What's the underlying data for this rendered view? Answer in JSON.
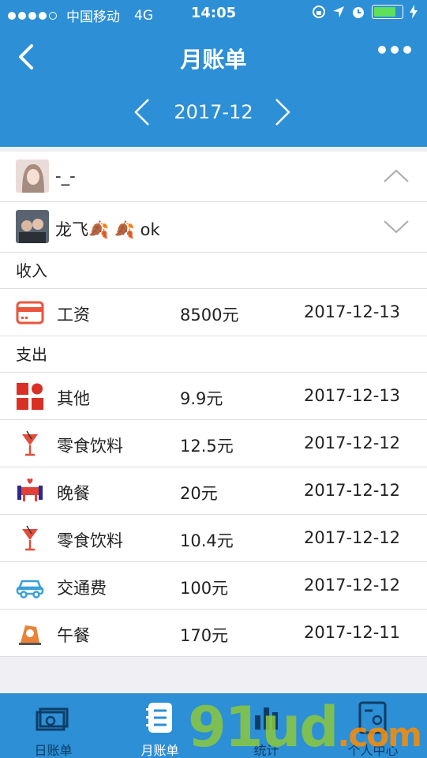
{
  "status_bar": {
    "carrier": "中国移动",
    "network": "4G",
    "time": "14:05"
  },
  "nav": {
    "title": "月账单"
  },
  "month_selector": {
    "value": "2017-12"
  },
  "users": [
    {
      "name": "-_-",
      "expanded": true
    },
    {
      "name": "龙飞🍂 🍂 ok",
      "expanded": false
    }
  ],
  "income": {
    "label": "收入",
    "items": [
      {
        "category": "工资",
        "amount": "8500元",
        "date": "2017-12-13",
        "icon": "wallet-icon"
      }
    ]
  },
  "expense": {
    "label": "支出",
    "items": [
      {
        "category": "其他",
        "amount": "9.9元",
        "date": "2017-12-13",
        "icon": "grid-other-icon"
      },
      {
        "category": "零食饮料",
        "amount": "12.5元",
        "date": "2017-12-12",
        "icon": "cocktail-icon"
      },
      {
        "category": "晚餐",
        "amount": "20元",
        "date": "2017-12-12",
        "icon": "dinner-table-icon"
      },
      {
        "category": "零食饮料",
        "amount": "10.4元",
        "date": "2017-12-12",
        "icon": "cocktail-icon"
      },
      {
        "category": "交通费",
        "amount": "100元",
        "date": "2017-12-12",
        "icon": "car-icon"
      },
      {
        "category": "午餐",
        "amount": "170元",
        "date": "2017-12-11",
        "icon": "lunch-icon"
      }
    ]
  },
  "tabbar": {
    "tabs": [
      {
        "label": "日账单",
        "active": false
      },
      {
        "label": "月账单",
        "active": true
      },
      {
        "label": "统计",
        "active": false
      },
      {
        "label": "个人中心",
        "active": false
      }
    ]
  },
  "watermark": {
    "main": "91ud",
    "suffix": ".com"
  },
  "colors": {
    "primary": "#2d8fd5",
    "background": "#efeff4"
  }
}
